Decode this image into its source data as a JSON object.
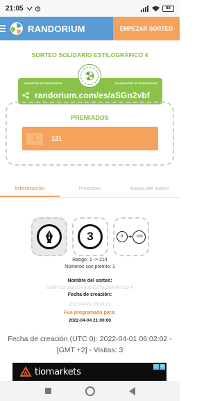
{
  "status_bar": {
    "time": "21:05",
    "battery": "88"
  },
  "header": {
    "brand": "RANDORIUM",
    "cta": "EMPEZAR SORTEO"
  },
  "raffle": {
    "title": "SORTEO SOLIDARIO ESTILOGRÁFICO 4",
    "guarantee_left": "GARANTÍA DE RANDORIUM",
    "guarantee_right": "GUARANTEE OF RANDORIUM",
    "url": "randorium.com/es/aSGn2vbf"
  },
  "winners": {
    "title": "PREMIADOS",
    "items": [
      {
        "position": "1",
        "number": "131"
      }
    ]
  },
  "tabs": [
    {
      "label": "Información",
      "active": true
    },
    {
      "label": "Presorteo",
      "active": false
    },
    {
      "label": "Bases del sorteo",
      "active": false
    }
  ],
  "info": {
    "quantity_icon_value": "3",
    "range_from": "0",
    "range_to": "100",
    "range_text": "Rango: 1 -> 214",
    "prize_numbers_text": "Números con premio: 1",
    "name_label": "Nombre del sorteo:",
    "name_value": "SORTEO SOLIDARIO ESTILOGRÁFICO 4",
    "created_label": "Fecha de creación:",
    "created_value": "2022-04-01 06:02:02",
    "scheduled_label": "Fue programado para:",
    "scheduled_value": "2022-04-04 21:00:00"
  },
  "footer_note": "Fecha de creación (UTC 0): 2022-04-01 06:02:02 - [GMT +2] - Visitas: 3",
  "ad": {
    "text": "tiomarkets"
  },
  "colors": {
    "header_blue": "#5a9bd4",
    "accent_orange": "#f5a25d",
    "accent_green": "#8bc34a",
    "title_green": "#8bbd3a"
  }
}
